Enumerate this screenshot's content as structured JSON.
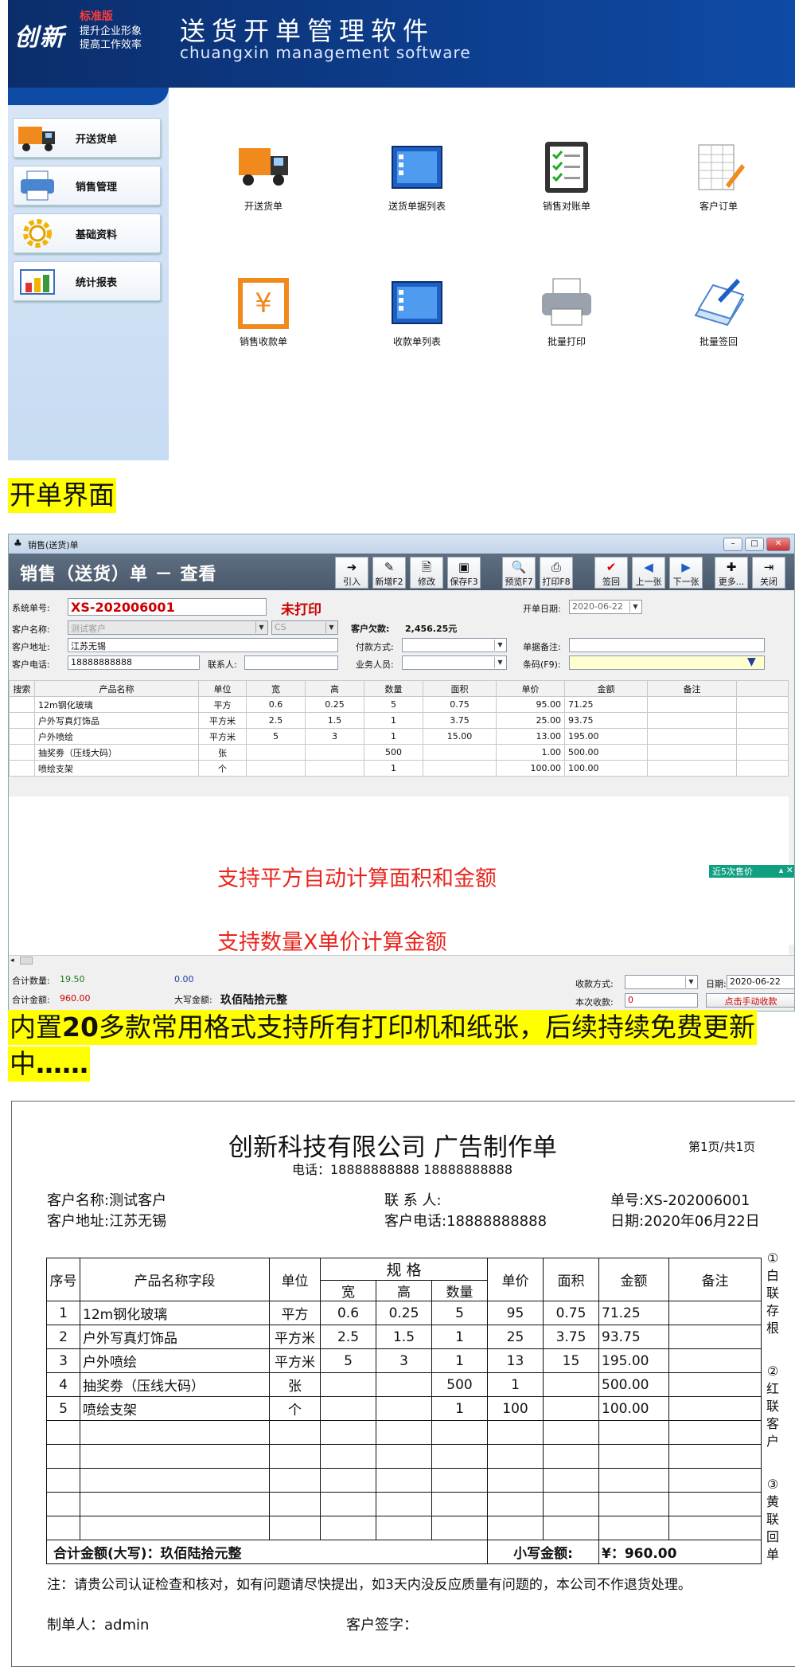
{
  "launcher": {
    "logo_text": "创新",
    "edition": "标准版",
    "slogan_1": "提升企业形象",
    "slogan_2": "提高工作效率",
    "title": "送货开单管理软件",
    "subtitle": "chuangxin management software",
    "sidebar": [
      {
        "label": "开送货单",
        "icon": "truck-icon"
      },
      {
        "label": "销售管理",
        "icon": "printer-icon"
      },
      {
        "label": "基础资料",
        "icon": "gear-icon"
      },
      {
        "label": "统计报表",
        "icon": "bar-chart-icon"
      }
    ],
    "tiles": [
      {
        "label": "开送货单",
        "icon": "truck-icon"
      },
      {
        "label": "送货单据列表",
        "icon": "list-window-icon"
      },
      {
        "label": "销售对账单",
        "icon": "checklist-icon"
      },
      {
        "label": "客户订单",
        "icon": "order-form-icon"
      },
      {
        "label": "销售收款单",
        "icon": "yen-receipt-icon"
      },
      {
        "label": "收款单列表",
        "icon": "list-window-icon"
      },
      {
        "label": "批量打印",
        "icon": "printer-icon"
      },
      {
        "label": "批量签回",
        "icon": "sign-back-icon"
      }
    ]
  },
  "banner_1": "开单界面",
  "banner_2": {
    "pre": "内置",
    "bold": "20",
    "post": "多款常用格式支持所有打印机和纸张，后续持续免费更新",
    "line2_pre": "中",
    "line2_bold": "……"
  },
  "sales_window": {
    "window_title": "销售(送货)单",
    "form_title": "销售（送货）单 － 查看",
    "toolbar": [
      {
        "label": "引入",
        "icon": "arrow-right-icon"
      },
      {
        "label": "新增F2",
        "icon": "new-doc-icon"
      },
      {
        "label": "修改",
        "icon": "edit-doc-icon"
      },
      {
        "label": "保存F3",
        "icon": "save-icon"
      },
      {
        "label": "预览F7",
        "icon": "preview-icon"
      },
      {
        "label": "打印F8",
        "icon": "print-icon"
      },
      {
        "label": "签回",
        "icon": "check-icon"
      },
      {
        "label": "上一张",
        "icon": "prev-icon"
      },
      {
        "label": "下一张",
        "icon": "next-icon"
      },
      {
        "label": "更多...",
        "icon": "more-icon"
      },
      {
        "label": "关闭",
        "icon": "close-door-icon"
      }
    ],
    "fields": {
      "sys_no_label": "系统单号:",
      "sys_no": "XS-202006001",
      "print_status": "未打印",
      "date_label": "开单日期:",
      "date": "2020-06-22",
      "customer_label": "客户名称:",
      "customer": "测试客户",
      "customer_code": "CS",
      "debt_label": "客户欠款:",
      "debt": "2,456.25元",
      "address_label": "客户地址:",
      "address": "江苏无锡",
      "pay_label": "付款方式:",
      "remark_label": "单据备注:",
      "phone_label": "客户电话:",
      "phone": "18888888888",
      "contact_label": "联系人:",
      "sales_label": "业务人员:",
      "barcode_label": "条码(F9):"
    },
    "grid": {
      "headers": [
        "搜索",
        "产品名称",
        "单位",
        "宽",
        "高",
        "数量",
        "面积",
        "单价",
        "金额",
        "备注"
      ],
      "rows": [
        [
          "",
          "12m钢化玻璃",
          "平方",
          "0.6",
          "0.25",
          "5",
          "0.75",
          "95.00",
          "71.25",
          ""
        ],
        [
          "",
          "户外写真灯饰品",
          "平方米",
          "2.5",
          "1.5",
          "1",
          "3.75",
          "25.00",
          "93.75",
          ""
        ],
        [
          "",
          "户外喷绘",
          "平方米",
          "5",
          "3",
          "1",
          "15.00",
          "13.00",
          "195.00",
          ""
        ],
        [
          "",
          "抽奖劵（压线大码）",
          "张",
          "",
          "",
          "500",
          "",
          "1.00",
          "500.00",
          ""
        ],
        [
          "",
          "喷绘支架",
          "个",
          "",
          "",
          "1",
          "",
          "100.00",
          "100.00",
          ""
        ]
      ]
    },
    "note_1": "支持平方自动计算面积和金额",
    "note_2": "支持数量X单价计算金额",
    "recent_label": "近5次售价",
    "status": {
      "qty_label": "合计数量:",
      "qty": "19.50",
      "qty2": "0.00",
      "amount_label": "合计金额:",
      "amount": "960.00",
      "upper_label": "大写金额:",
      "upper": "玖佰陆拾元整",
      "collect_method_label": "收款方式:",
      "date_label": "日期:",
      "date": "2020-06-22",
      "collect_label": "本次收款:",
      "collect_value": "0",
      "manual_collect": "点击手动收款"
    }
  },
  "print_form": {
    "company_title": "创新科技有限公司 广告制作单",
    "phone_line": "电话：18888888888  18888888888",
    "page": "第1页/共1页",
    "customer": "客户名称:测试客户",
    "address": "客户地址:江苏无锡",
    "contact": "联 系 人:",
    "phone": "客户电话:18888888888",
    "order_no": "单号:XS-202006001",
    "date": "日期:2020年06月22日",
    "headers": {
      "seq": "序号",
      "name": "产品名称字段",
      "unit": "单位",
      "spec": "规 格",
      "w": "宽",
      "h": "高",
      "qty": "数量",
      "price": "单价",
      "area": "面积",
      "amount": "金额",
      "remark": "备注"
    },
    "rows": [
      [
        "1",
        "12m钢化玻璃",
        "平方",
        "0.6",
        "0.25",
        "5",
        "95",
        "0.75",
        "71.25",
        ""
      ],
      [
        "2",
        "户外写真灯饰品",
        "平方米",
        "2.5",
        "1.5",
        "1",
        "25",
        "3.75",
        "93.75",
        ""
      ],
      [
        "3",
        "户外喷绘",
        "平方米",
        "5",
        "3",
        "1",
        "13",
        "15",
        "195.00",
        ""
      ],
      [
        "4",
        "抽奖劵（压线大码）",
        "张",
        "",
        "",
        "500",
        "1",
        "",
        "500.00",
        ""
      ],
      [
        "5",
        "喷绘支架",
        "个",
        "",
        "",
        "1",
        "100",
        "",
        "100.00",
        ""
      ]
    ],
    "total_upper": "合计金额(大写)：玖佰陆拾元整",
    "total_small_label": "小写金额:",
    "total_small": "¥：960.00",
    "note": "注：请贵公司认证检查和核对，如有问题请尽快提出，如3天内没反应质量有问题的，本公司不作退货处理。",
    "maker": "制单人：admin",
    "sign": "客户签字：",
    "copies": [
      "①白联存根",
      "②红联客户",
      "③黄联回单"
    ]
  }
}
